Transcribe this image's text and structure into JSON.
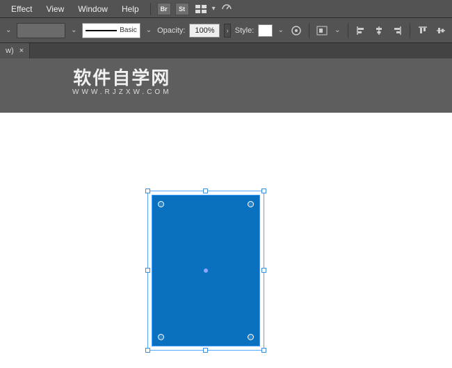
{
  "menubar": {
    "items": [
      "Effect",
      "View",
      "Window",
      "Help"
    ],
    "icons": {
      "bridge": "Br",
      "stock": "St"
    }
  },
  "toolbar": {
    "stroke_profile_label": "Basic",
    "opacity_label": "Opacity:",
    "opacity_value": "100%",
    "style_label": "Style:"
  },
  "tabbar": {
    "tab_label": "w)",
    "tab_close": "×"
  },
  "watermark": {
    "main": "软件自学网",
    "sub": "WWW.RJZXW.COM"
  },
  "shape": {
    "fill": "#0a71c0"
  }
}
